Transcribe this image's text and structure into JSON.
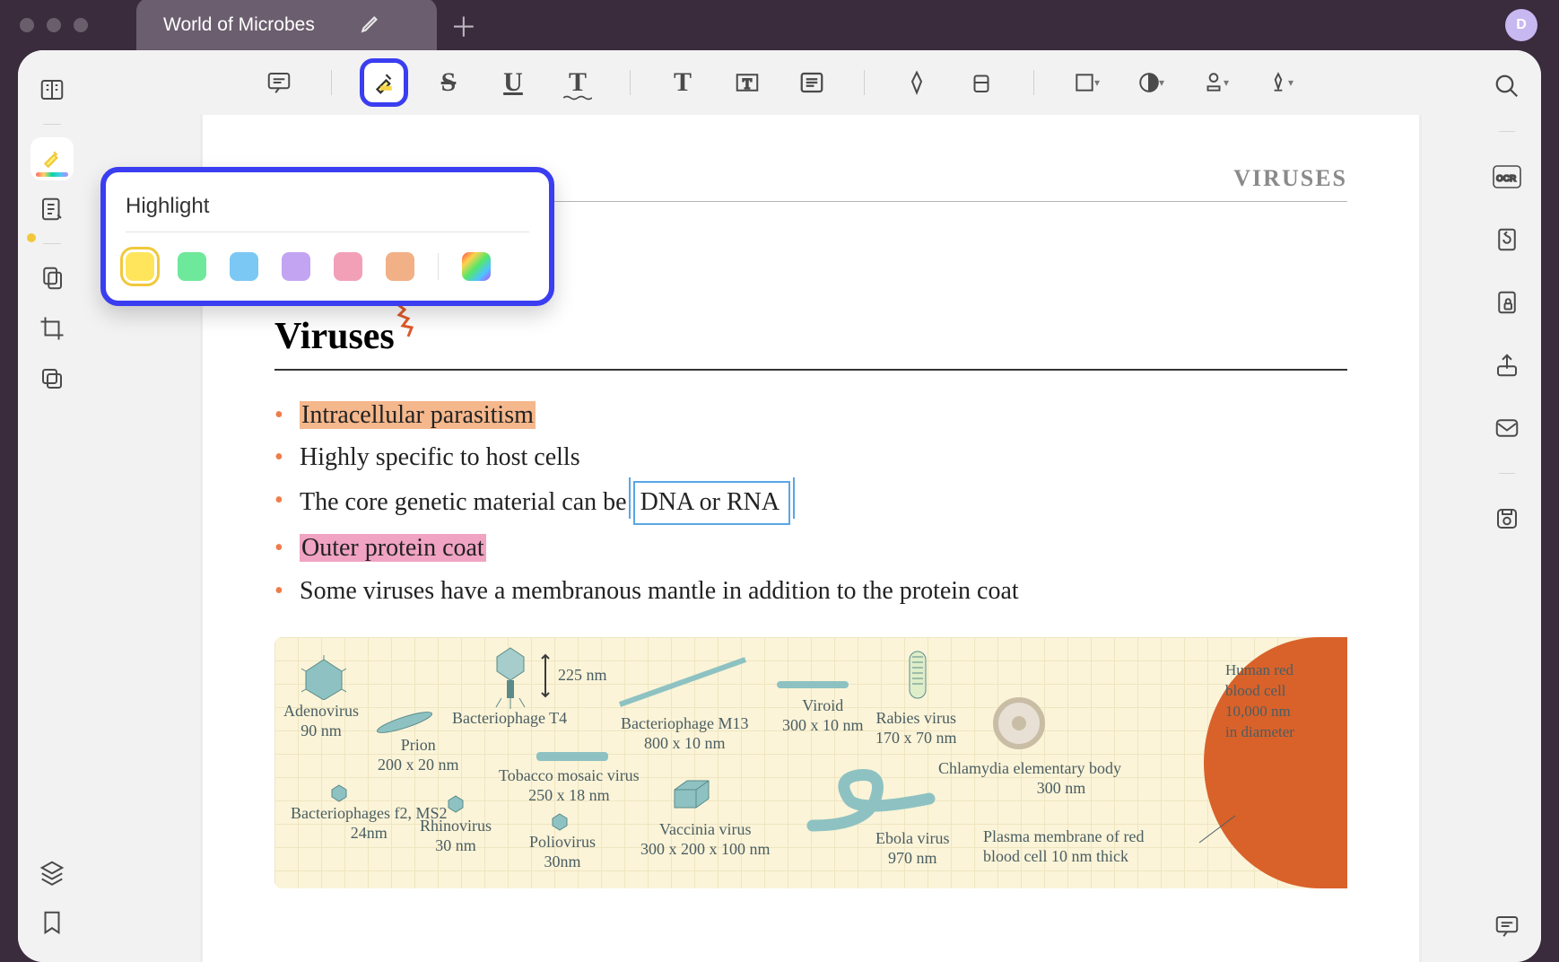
{
  "window": {
    "tab_title": "World of Microbes",
    "avatar_letter": "D"
  },
  "popover": {
    "title": "Highlight",
    "colors": [
      "yellow",
      "green",
      "blue",
      "purple",
      "pink",
      "orange",
      "rainbow"
    ],
    "selected": "yellow"
  },
  "document": {
    "header": "VIRUSES",
    "title": "Viruses",
    "bullets": [
      {
        "text": "Intracellular parasitism",
        "style": "hl-orange"
      },
      {
        "text": "Highly specific to host cells",
        "style": ""
      },
      {
        "prefix": "The core genetic material can be ",
        "boxed": "DNA or RNA"
      },
      {
        "text": "Outer protein coat",
        "style": "hl-pink"
      },
      {
        "text": "Some viruses have a membranous mantle in addition to the protein coat",
        "style": ""
      }
    ]
  },
  "diagram": {
    "items": [
      {
        "name": "Adenovirus",
        "size": "90 nm"
      },
      {
        "name": "Bacteriophage T4",
        "size": "225 nm"
      },
      {
        "name": "Prion",
        "size": "200 x 20 nm"
      },
      {
        "name": "Bacteriophage M13",
        "size": "800 x 10 nm"
      },
      {
        "name": "Viroid",
        "size": "300 x 10 nm"
      },
      {
        "name": "Rabies virus",
        "size": "170 x 70 nm"
      },
      {
        "name": "Bacteriophages f2, MS2",
        "size": "24nm"
      },
      {
        "name": "Rhinovirus",
        "size": "30 nm"
      },
      {
        "name": "Tobacco mosaic virus",
        "size": "250 x 18 nm"
      },
      {
        "name": "Poliovirus",
        "size": "30nm"
      },
      {
        "name": "Vaccinia virus",
        "size": "300 x 200 x 100 nm"
      },
      {
        "name": "Ebola virus",
        "size": "970 nm"
      },
      {
        "name": "Chlamydia elementary body",
        "size": "300 nm"
      }
    ],
    "cell": {
      "line1": "Human red",
      "line2": "blood cell",
      "line3": "10,000 nm",
      "line4": "in diameter"
    },
    "membrane_note1": "Plasma membrane of red",
    "membrane_note2": "blood cell 10 nm thick"
  }
}
